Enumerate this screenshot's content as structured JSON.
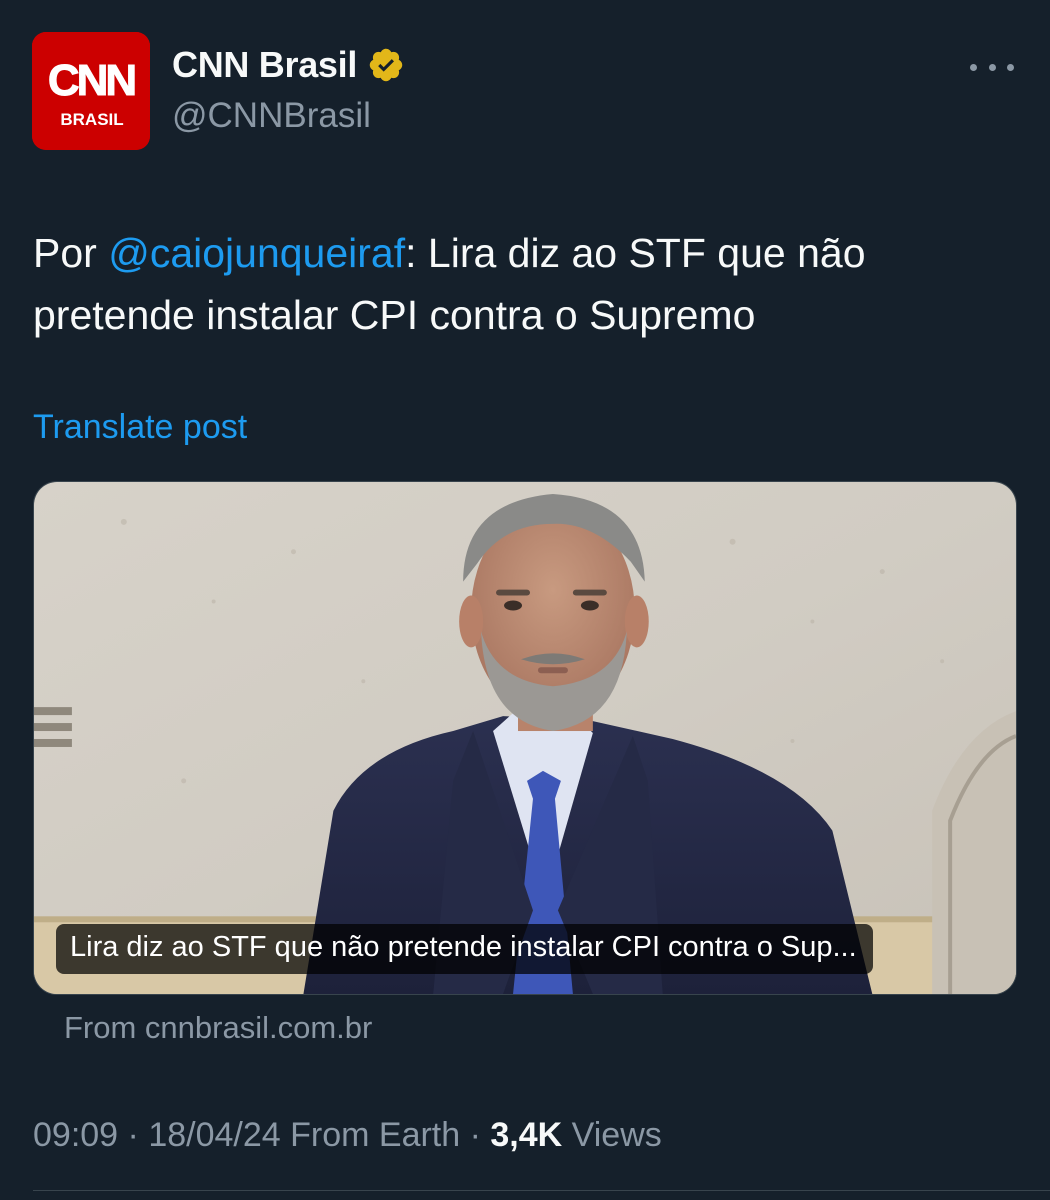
{
  "author": {
    "display_name": "CNN Brasil",
    "handle": "@CNNBrasil",
    "avatar_logo_text": "CNN",
    "avatar_sub_text": "BRASIL",
    "verified_color": "#e2b719"
  },
  "post": {
    "text_prefix": "Por ",
    "mention": "@caiojunqueiraf",
    "text_body": ": Lira diz ao STF que não pretende instalar CPI contra o Supremo",
    "translate_label": "Translate post"
  },
  "link_card": {
    "caption": "Lira diz ao STF que não pretende instalar CPI contra o Sup...",
    "source": "From cnnbrasil.com.br"
  },
  "meta": {
    "time": "09:09",
    "separator": " · ",
    "date": "18/04/24",
    "location": "From Earth",
    "views_count": "3,4K",
    "views_label": "Views"
  },
  "colors": {
    "background": "#15202b",
    "accent": "#1d9bf0",
    "muted": "#8b98a5",
    "avatar_bg": "#cc0000"
  }
}
